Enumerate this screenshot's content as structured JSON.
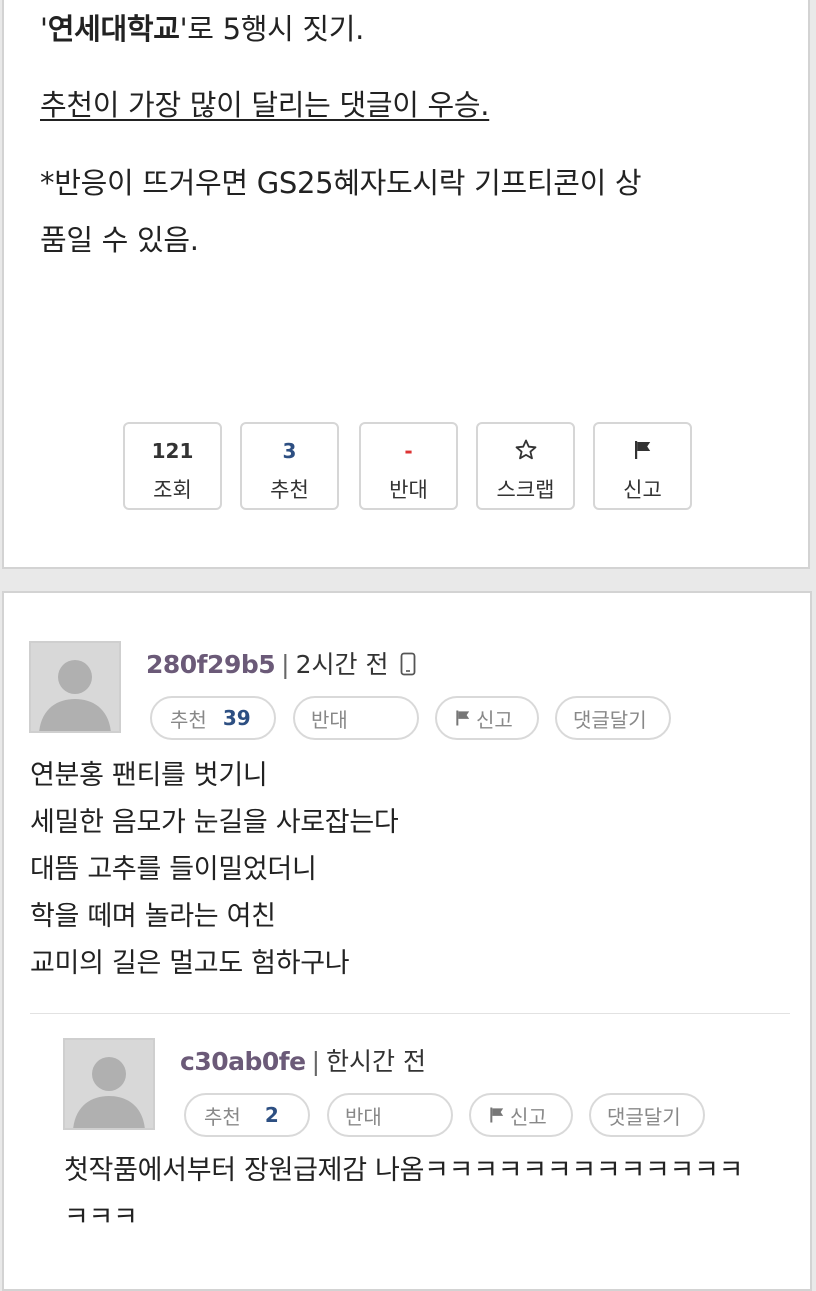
{
  "post": {
    "line1_quote_open": "'",
    "line1_bold": "연세대학교",
    "line1_rest": "'로 5행시 짓기.",
    "line2": "추천이 가장 많이 달리는 댓글이 우승.",
    "line3": "*반응이 뜨거우면 GS25혜자도시락 기프티콘이 상",
    "line4": "품일 수 있음."
  },
  "stats": {
    "views_value": "121",
    "views_label": "조회",
    "recommend_value": "3",
    "recommend_label": "추천",
    "oppose_value": "-",
    "oppose_label": "반대",
    "scrap_label": "스크랩",
    "scrap_icon": "star-outline-icon",
    "report_label": "신고",
    "report_icon": "flag-icon"
  },
  "comments": [
    {
      "nickname": "280f29b5",
      "time": "2시간 전",
      "device_icon": "mobile-phone-icon",
      "recommend_label": "추천",
      "recommend_count": "39",
      "oppose_label": "반대",
      "report_label": "신고",
      "reply_label": "댓글달기",
      "lines": [
        "연분홍 팬티를 벗기니",
        "세밀한 음모가 눈길을 사로잡는다",
        "대뜸 고추를 들이밀었더니",
        "학을 떼며 놀라는 여친",
        "교미의 길은 멀고도 험하구나"
      ]
    },
    {
      "nickname": "c30ab0fe",
      "time": "한시간 전",
      "recommend_label": "추천",
      "recommend_count": "2",
      "oppose_label": "반대",
      "report_label": "신고",
      "reply_label": "댓글달기",
      "lines": [
        "첫작품에서부터 장원급제감 나옴ㅋㅋㅋㅋㅋㅋㅋㅋㅋㅋㅋㅋㅋ",
        "ㅋㅋㅋ"
      ]
    }
  ],
  "colors": {
    "nickname": "#6b5a78",
    "count_blue": "#2d4f82",
    "oppose_red": "#dd3333",
    "border": "#d6d6d6"
  }
}
